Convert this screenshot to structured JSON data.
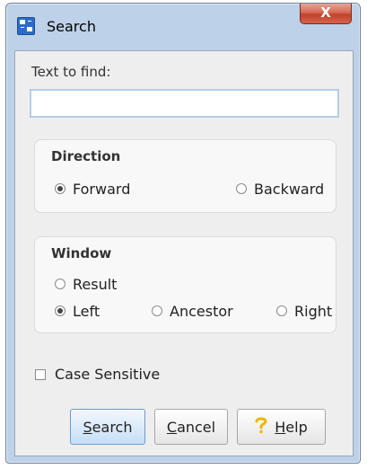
{
  "window": {
    "title": "Search",
    "close_glyph": "X"
  },
  "find": {
    "label": "Text to find:",
    "value": "",
    "placeholder": ""
  },
  "direction": {
    "title": "Direction",
    "options": [
      {
        "label": "Forward",
        "checked": true
      },
      {
        "label": "Backward",
        "checked": false
      }
    ]
  },
  "window_group": {
    "title": "Window",
    "options": [
      {
        "label": "Result",
        "checked": false
      },
      {
        "label": "Left",
        "checked": true
      },
      {
        "label": "Ancestor",
        "checked": false
      },
      {
        "label": "Right",
        "checked": false
      }
    ]
  },
  "case_sensitive": {
    "label": "Case Sensitive",
    "checked": false
  },
  "buttons": {
    "search": {
      "mnemonic": "S",
      "rest": "earch"
    },
    "cancel": {
      "mnemonic": "C",
      "rest": "ancel"
    },
    "help": {
      "mnemonic": "H",
      "rest": "elp",
      "icon": "question-mark-icon"
    }
  },
  "colors": {
    "frame": "#bdd1e8",
    "client_bg": "#eeeeee",
    "close_red": "#c2402a",
    "help_icon": "#f2b400",
    "default_button_border": "#6d9bd0"
  }
}
